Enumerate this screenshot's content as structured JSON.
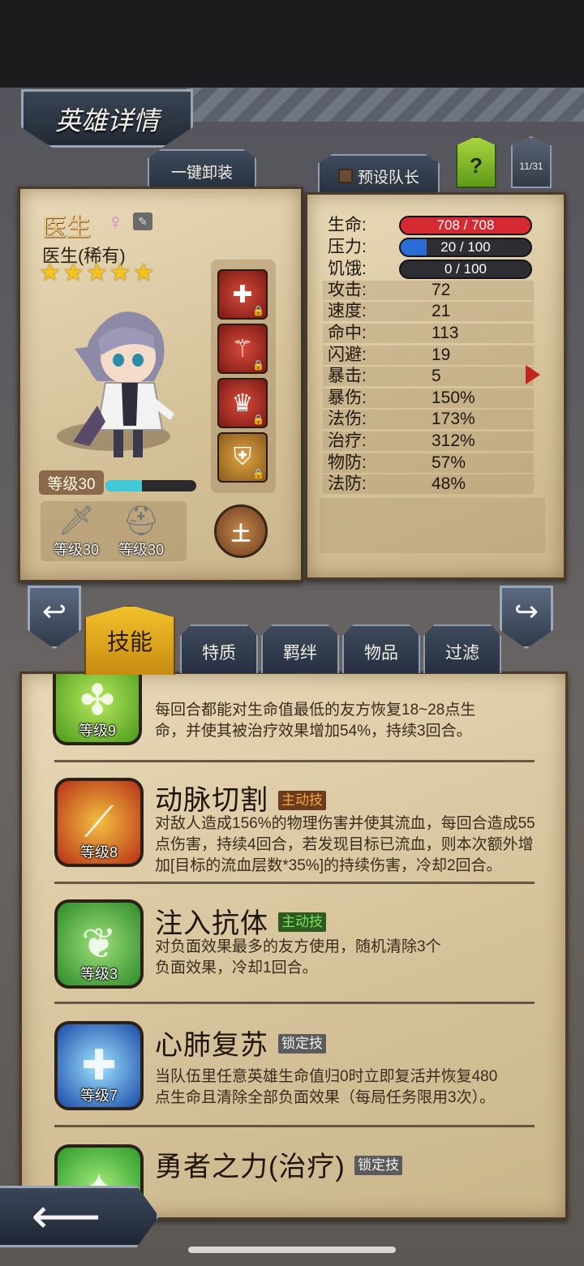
{
  "header": {
    "title": "英雄详情",
    "unequip_all": "一键卸装",
    "preset_leader": "预设队长",
    "help": "?",
    "page_indicator": "11/31"
  },
  "hero": {
    "name": "医生",
    "subtitle": "医生(稀有)",
    "stars": 5,
    "level_label": "等级30",
    "xp_fraction": 0.4,
    "element": "土"
  },
  "equipment": [
    {
      "icon": "sword-icon",
      "level_label": "等级30"
    },
    {
      "icon": "helmet-icon",
      "level_label": "等级30"
    }
  ],
  "skill_slots": [
    {
      "icon": "medkit-icon"
    },
    {
      "icon": "staff-icon"
    },
    {
      "icon": "crown-icon"
    },
    {
      "icon": "shield-icon"
    }
  ],
  "stats": {
    "bars": [
      {
        "label": "生命:",
        "text": "708 / 708",
        "fraction": 1.0,
        "color": "#d62a33"
      },
      {
        "label": "压力:",
        "text": "20 / 100",
        "fraction": 0.2,
        "color": "#2a6cd6"
      },
      {
        "label": "饥饿:",
        "text": "0 / 100",
        "fraction": 0.0,
        "color": "#888888"
      }
    ],
    "rows": [
      {
        "label": "攻击:",
        "value": "72"
      },
      {
        "label": "速度:",
        "value": "21"
      },
      {
        "label": "命中:",
        "value": "113"
      },
      {
        "label": "闪避:",
        "value": "19"
      },
      {
        "label": "暴击:",
        "value": "5"
      },
      {
        "label": "暴伤:",
        "value": "150%"
      },
      {
        "label": "法伤:",
        "value": "173%"
      },
      {
        "label": "治疗:",
        "value": "312%"
      },
      {
        "label": "物防:",
        "value": "57%"
      },
      {
        "label": "法防:",
        "value": "48%"
      }
    ]
  },
  "tabs": [
    "技能",
    "特质",
    "羁绊",
    "物品",
    "过滤"
  ],
  "skills": [
    {
      "name": "",
      "tag": "",
      "level": "等级9",
      "desc": [
        "每回合都能对生命值最低的友方恢复18~28点生",
        "命，并使其被治疗效果增加54%，持续3回合。"
      ]
    },
    {
      "name": "动脉切割",
      "tag": "主动技",
      "level": "等级8",
      "desc": [
        "对敌人造成156%的物理伤害并使其流血，每回合造成55",
        "点伤害，持续4回合，若发现目标已流血，则本次额外增",
        "加[目标的流血层数*35%]的持续伤害，冷却2回合。"
      ]
    },
    {
      "name": "注入抗体",
      "tag": "主动技",
      "level": "等级3",
      "desc": [
        "对负面效果最多的友方使用，随机清除3个",
        "负面效果，冷却1回合。"
      ]
    },
    {
      "name": "心肺复苏",
      "tag": "锁定技",
      "level": "等级7",
      "desc": [
        "当队伍里任意英雄生命值归0时立即复活并恢复480",
        "点生命且清除全部负面效果（每局任务限用3次）。"
      ]
    },
    {
      "name": "勇者之力(治疗)",
      "tag": "锁定技",
      "level": "",
      "desc": []
    }
  ]
}
